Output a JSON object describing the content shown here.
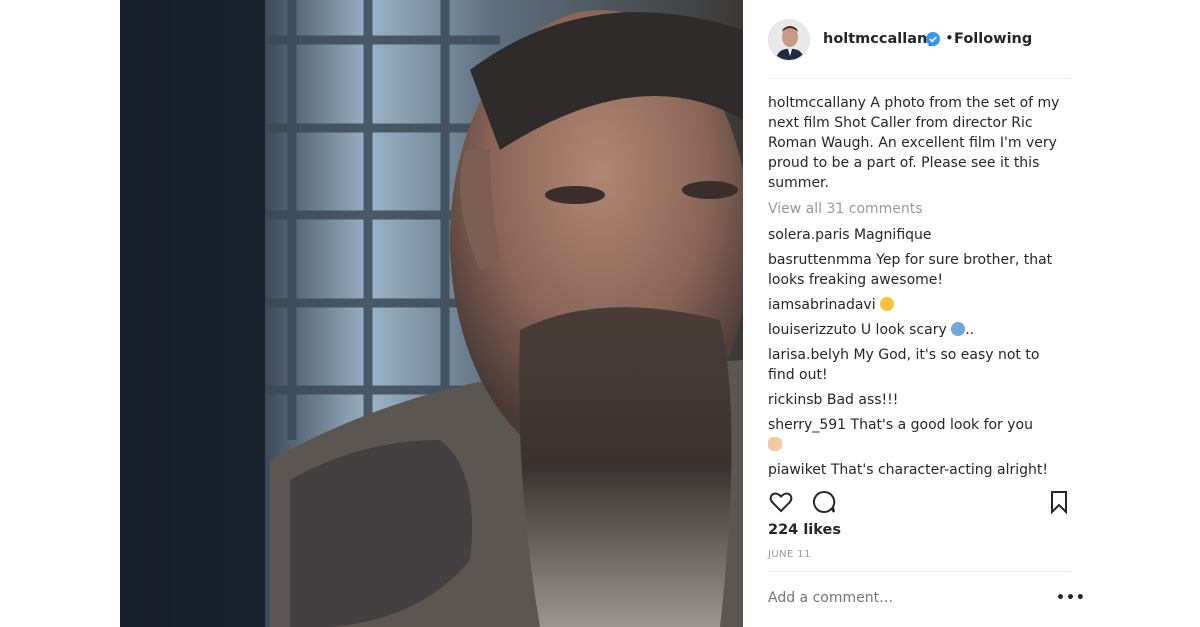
{
  "post": {
    "username": "holtmccallany",
    "follow_state": "Following",
    "separator": "•",
    "caption_username": "holtmccallany",
    "caption_text": "A photo from the set of my next film Shot Caller from director Ric Roman Waugh. An excellent film I'm very proud to be a part of. Please see it this summer.",
    "view_all_comments": "View all 31 comments",
    "likes": "224 likes",
    "date": "JUNE 11",
    "add_comment_placeholder": "Add a comment…",
    "more_options": "•••"
  },
  "comments": [
    {
      "user": "solera.paris",
      "text": "Magnifique",
      "emoji": ""
    },
    {
      "user": "basruttenmma",
      "text": "Yep for sure brother, that looks freaking awesome!",
      "emoji": ""
    },
    {
      "user": "iamsabrinadavi",
      "text": "",
      "emoji": "unamused"
    },
    {
      "user": "louiserizzuto",
      "text": "U look scary",
      "emoji": "scream",
      "suffix": ".."
    },
    {
      "user": "larisa.belyh",
      "text": "My God, it's so easy not to find out!",
      "emoji": ""
    },
    {
      "user": "rickinsb",
      "text": "Bad ass!!!",
      "emoji": ""
    },
    {
      "user": "sherry_591",
      "text": "That's a good look for you",
      "emoji": "hand"
    },
    {
      "user": "piawiket",
      "text": "That's character-acting alright!",
      "emoji": ""
    }
  ],
  "icons": {
    "verified": "verified-badge-icon",
    "like": "heart-icon",
    "comment": "comment-bubble-icon",
    "save": "bookmark-icon"
  },
  "colors": {
    "verified": "#3897f0",
    "secondary_text": "#999999",
    "primary_text": "#262626",
    "divider": "#efefef"
  }
}
